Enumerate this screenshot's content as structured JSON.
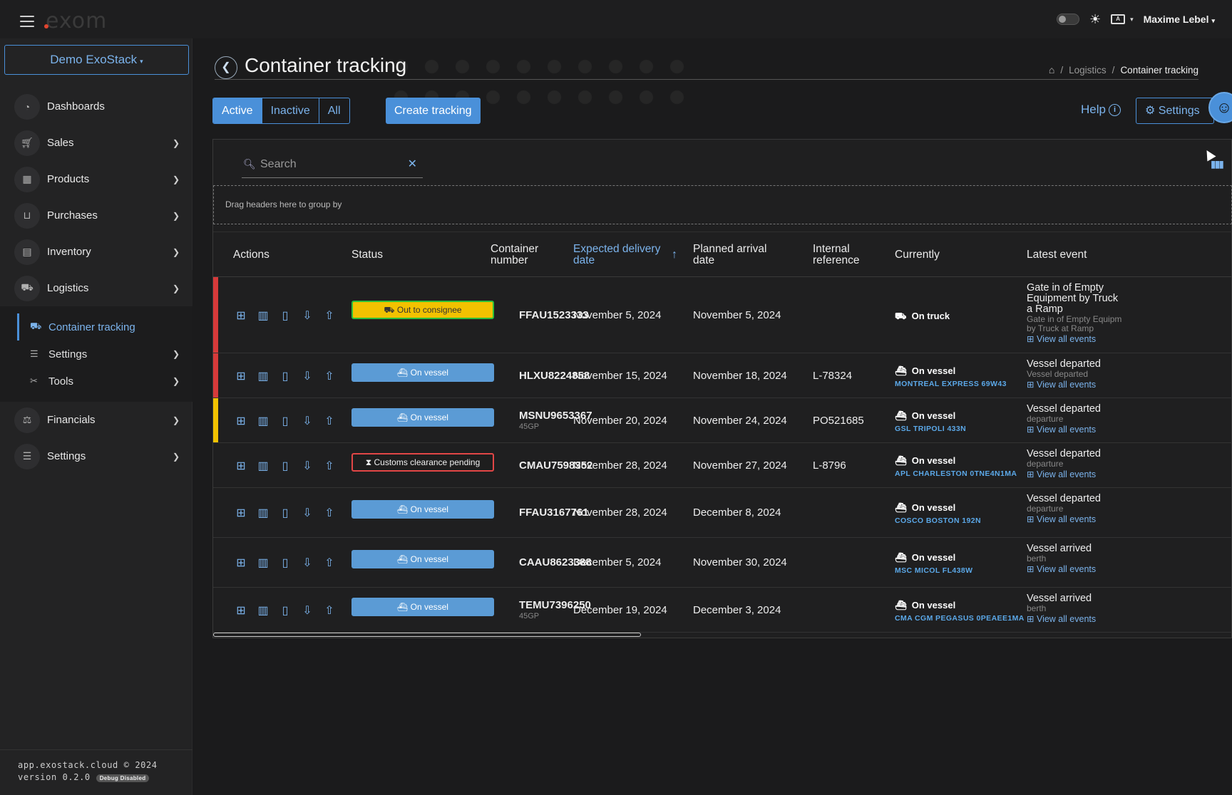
{
  "topbar": {
    "logo_text": "exom",
    "user_name": "Maxime Lebel",
    "theme_icon": "sun-icon",
    "lang_badge": "A"
  },
  "sidebar": {
    "org_button": "Demo ExoStack",
    "items": [
      {
        "label": "Dashboards",
        "icon": "dashboard-icon"
      },
      {
        "label": "Sales",
        "icon": "cart-icon"
      },
      {
        "label": "Products",
        "icon": "boxes-icon"
      },
      {
        "label": "Purchases",
        "icon": "basket-icon"
      },
      {
        "label": "Inventory",
        "icon": "warehouse-icon"
      },
      {
        "label": "Logistics",
        "icon": "truck-icon"
      }
    ],
    "logistics_sub": [
      {
        "label": "Container tracking",
        "icon": "truck-icon"
      },
      {
        "label": "Settings",
        "icon": "sliders-icon"
      },
      {
        "label": "Tools",
        "icon": "tools-icon"
      }
    ],
    "bottom_items": [
      {
        "label": "Financials",
        "icon": "scale-icon"
      },
      {
        "label": "Settings",
        "icon": "sliders-icon"
      }
    ],
    "footer": {
      "site": "app.exostack.cloud © 2024",
      "version": "version 0.2.0",
      "debug": "Debug Disabled"
    }
  },
  "page": {
    "title": "Container tracking",
    "breadcrumb": [
      "Logistics",
      "Container tracking"
    ]
  },
  "toolbar": {
    "filters": [
      "Active",
      "Inactive",
      "All"
    ],
    "active_filter": "Active",
    "create_label": "Create tracking",
    "help_label": "Help",
    "settings_label": "Settings"
  },
  "grid": {
    "search_placeholder": "Search",
    "group_hint": "Drag headers here to group by",
    "columns": {
      "actions": "Actions",
      "status": "Status",
      "container_number": "Container number",
      "expected_delivery": "Expected delivery date",
      "planned_arrival": "Planned arrival date",
      "internal_reference": "Internal reference",
      "currently": "Currently",
      "latest_event": "Latest event"
    },
    "view_all_label": "View all events",
    "rows": [
      {
        "flag_color": "#d63a3a",
        "status": "Out to consignee",
        "status_kind": "consignee",
        "container": "FFAU1523333",
        "container_sub": "",
        "expected": "November 5, 2024",
        "planned": "November 5, 2024",
        "reference": "",
        "currently": "On truck",
        "currently_sub": "",
        "event_title": "Gate in of Empty Equipment by Truck a Ramp",
        "event_sub": "Gate in of Empty Equipm by Truck at Ramp"
      },
      {
        "flag_color": "#d63a3a",
        "status": "On vessel",
        "status_kind": "vessel",
        "container": "HLXU8224858",
        "container_sub": "",
        "expected": "November 15, 2024",
        "planned": "November 18, 2024",
        "reference": "L-78324",
        "currently": "On vessel",
        "currently_sub": "MONTREAL EXPRESS 69W43",
        "event_title": "Vessel departed",
        "event_sub": "Vessel departed"
      },
      {
        "flag_color": "#f2c200",
        "status": "On vessel",
        "status_kind": "vessel",
        "container": "MSNU9653367",
        "container_sub": "45GP",
        "expected": "November 20, 2024",
        "planned": "November 24, 2024",
        "reference": "PO521685",
        "currently": "On vessel",
        "currently_sub": "GSL TRIPOLI 433N",
        "event_title": "Vessel departed",
        "event_sub": "departure"
      },
      {
        "flag_color": "",
        "status": "Customs clearance pending",
        "status_kind": "customs",
        "container": "CMAU7598352",
        "container_sub": "",
        "expected": "November 28, 2024",
        "planned": "November 27, 2024",
        "reference": "L-8796",
        "currently": "On vessel",
        "currently_sub": "APL CHARLESTON 0TNE4N1MA",
        "event_title": "Vessel departed",
        "event_sub": "departure"
      },
      {
        "flag_color": "",
        "status": "On vessel",
        "status_kind": "vessel",
        "container": "FFAU3167761",
        "container_sub": "",
        "expected": "November 28, 2024",
        "planned": "December 8, 2024",
        "reference": "",
        "currently": "On vessel",
        "currently_sub": "COSCO BOSTON 192N",
        "event_title": "Vessel departed",
        "event_sub": "departure"
      },
      {
        "flag_color": "",
        "status": "On vessel",
        "status_kind": "vessel",
        "container": "CAAU8623388",
        "container_sub": "",
        "expected": "December 5, 2024",
        "planned": "November 30, 2024",
        "reference": "",
        "currently": "On vessel",
        "currently_sub": "MSC MICOL FL438W",
        "event_title": "Vessel arrived",
        "event_sub": "berth"
      },
      {
        "flag_color": "",
        "status": "On vessel",
        "status_kind": "vessel",
        "container": "TEMU7396250",
        "container_sub": "45GP",
        "expected": "December 19, 2024",
        "planned": "December 3, 2024",
        "reference": "",
        "currently": "On vessel",
        "currently_sub": "CMA CGM PEGASUS 0PEAEE1MA",
        "event_title": "Vessel arrived",
        "event_sub": "berth"
      }
    ]
  }
}
